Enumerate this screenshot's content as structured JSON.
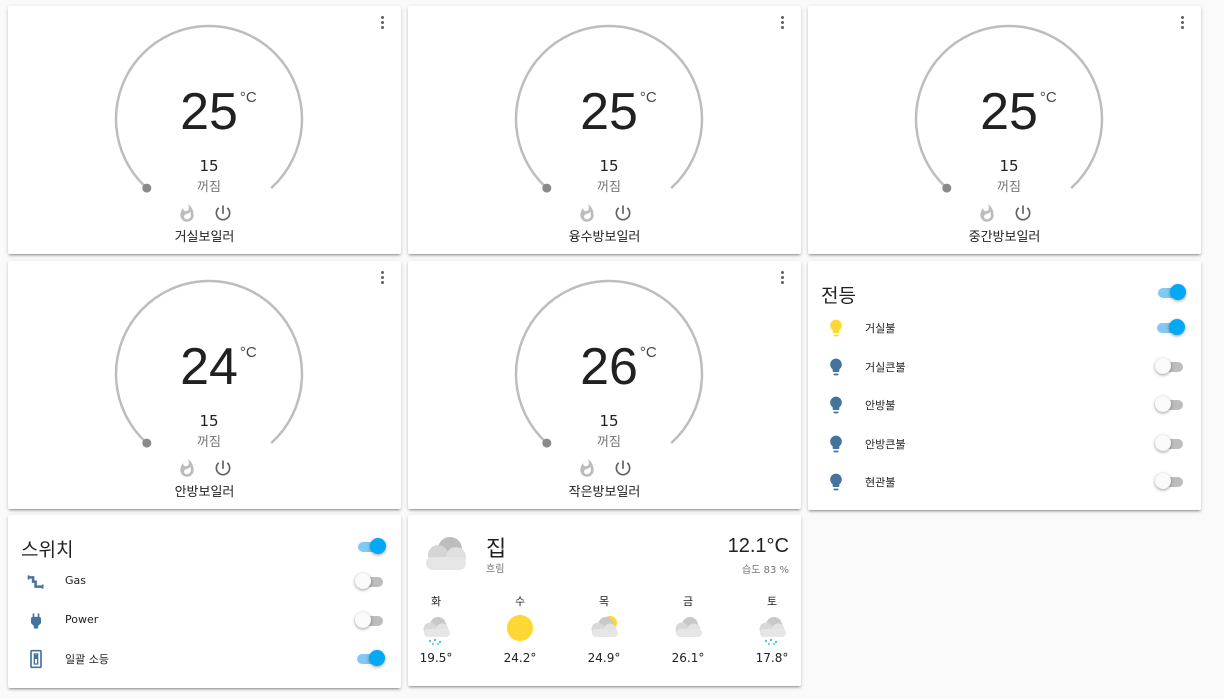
{
  "thermostats": [
    {
      "current": "25",
      "unit": "°C",
      "target": "15",
      "mode": "꺼짐",
      "name": "거실보일러"
    },
    {
      "current": "25",
      "unit": "°C",
      "target": "15",
      "mode": "꺼짐",
      "name": "융수방보일러"
    },
    {
      "current": "25",
      "unit": "°C",
      "target": "15",
      "mode": "꺼짐",
      "name": "중간방보일러"
    },
    {
      "current": "24",
      "unit": "°C",
      "target": "15",
      "mode": "꺼짐",
      "name": "안방보일러"
    },
    {
      "current": "26",
      "unit": "°C",
      "target": "15",
      "mode": "꺼짐",
      "name": "작은방보일러"
    }
  ],
  "lights": {
    "title": "전등",
    "all_on": true,
    "items": [
      {
        "label": "거실불",
        "on": true,
        "icon": "lightbulb-icon"
      },
      {
        "label": "거실큰불",
        "on": false,
        "icon": "lightbulb-icon"
      },
      {
        "label": "안방불",
        "on": false,
        "icon": "lightbulb-icon"
      },
      {
        "label": "안방큰불",
        "on": false,
        "icon": "lightbulb-icon"
      },
      {
        "label": "현관불",
        "on": false,
        "icon": "lightbulb-icon"
      }
    ]
  },
  "switches": {
    "title": "스위치",
    "all_on": true,
    "items": [
      {
        "label": "Gas",
        "on": false,
        "icon": "gas-pipe-icon"
      },
      {
        "label": "Power",
        "on": false,
        "icon": "power-plug-icon"
      },
      {
        "label": "일괄 소등",
        "on": true,
        "icon": "light-switch-icon"
      }
    ]
  },
  "weather": {
    "name": "집",
    "condition": "흐림",
    "temperature": "12.1°C",
    "humidity": "습도 83 %",
    "icon": "cloudy-icon",
    "forecast": [
      {
        "day": "화",
        "temp": "19.5°",
        "icon": "snowy-rainy-icon"
      },
      {
        "day": "수",
        "temp": "24.2°",
        "icon": "sunny-icon"
      },
      {
        "day": "목",
        "temp": "24.9°",
        "icon": "partly-cloudy-icon"
      },
      {
        "day": "금",
        "temp": "26.1°",
        "icon": "cloudy-icon"
      },
      {
        "day": "토",
        "temp": "17.8°",
        "icon": "snowy-rainy-icon"
      }
    ]
  },
  "colors": {
    "accent": "#03a9f4",
    "bulb_on": "#fdd835",
    "bulb_off": "#44739e",
    "dial": "#bdbdbd"
  }
}
